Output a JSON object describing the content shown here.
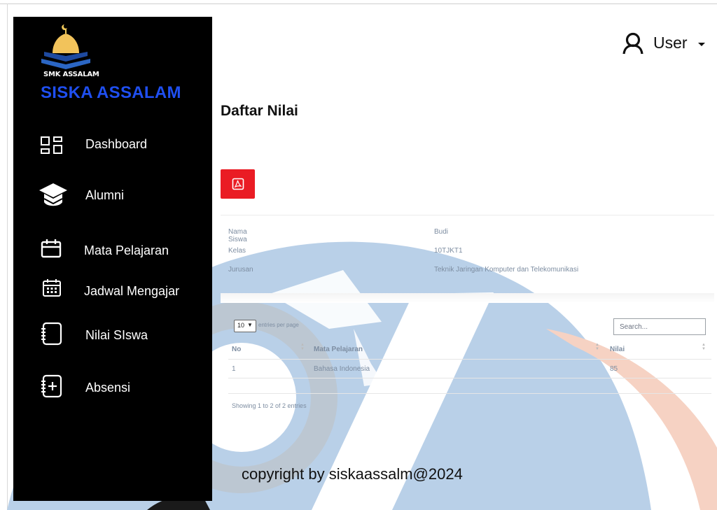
{
  "sidebar": {
    "logo_caption": "SMK ASSALAM",
    "brand": "SISKA ASSALAM",
    "items": [
      {
        "label": "Dashboard",
        "icon": "dashboard-grid-icon"
      },
      {
        "label": "Alumni",
        "icon": "graduation-cap-icon"
      },
      {
        "label": "Mata Pelajaran",
        "icon": "calendar-icon"
      },
      {
        "label": "Jadwal Mengajar",
        "icon": "calendar-grid-icon"
      },
      {
        "label": "Nilai SIswa",
        "icon": "notebook-icon"
      },
      {
        "label": "Absensi",
        "icon": "notebook-add-icon"
      }
    ]
  },
  "header": {
    "user_label": "User",
    "user_icon": "user-icon"
  },
  "main": {
    "title": "Daftar Nilai",
    "pdf_icon": "pdf-icon",
    "info": [
      {
        "label": "Nama Siswa",
        "value": "Budi"
      },
      {
        "label": "Kelas",
        "value": "10TJKT1"
      },
      {
        "label": "Jurusan",
        "value": "Teknik Jaringan Komputer dan Telekomunikasi"
      }
    ],
    "table": {
      "page_length": "10",
      "entries_label": "entries per page",
      "search_placeholder": "Search...",
      "columns": [
        "No",
        "Mata Pelajaran",
        "Nilai"
      ],
      "rows": [
        [
          "1",
          "Bahasa Indonesia",
          "85"
        ]
      ],
      "footer": "Showing 1 to 2 of 2 entries"
    },
    "copyright": "copyright by siskaassalm@2024"
  },
  "colors": {
    "sidebar_bg": "#000000",
    "brand": "#1f4ff0",
    "pdf_button": "#ea1c24",
    "watermark_blue": "#b5cde6",
    "watermark_orange": "#f6d2c3"
  }
}
